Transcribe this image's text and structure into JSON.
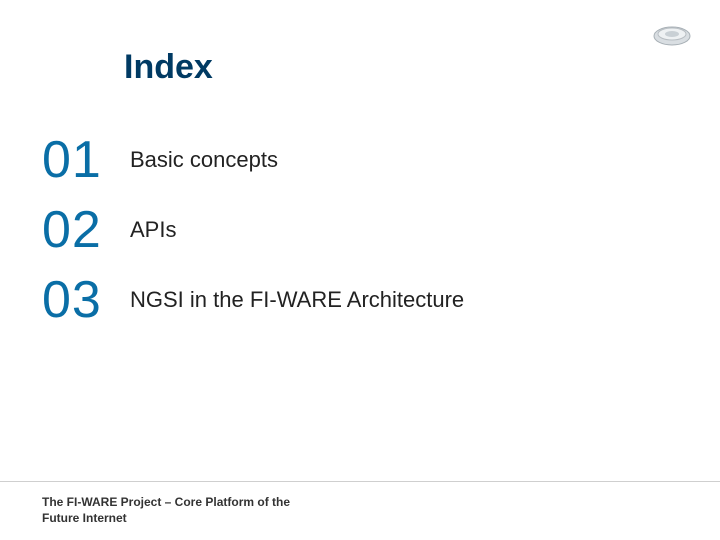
{
  "title": "Index",
  "items": [
    {
      "num": "01",
      "label": "Basic concepts"
    },
    {
      "num": "02",
      "label": "APIs"
    },
    {
      "num": "03",
      "label": "NGSI in the FI-WARE Architecture"
    }
  ],
  "footer": {
    "line1": "The FI-WARE Project – Core Platform of the",
    "line2": "Future Internet"
  }
}
